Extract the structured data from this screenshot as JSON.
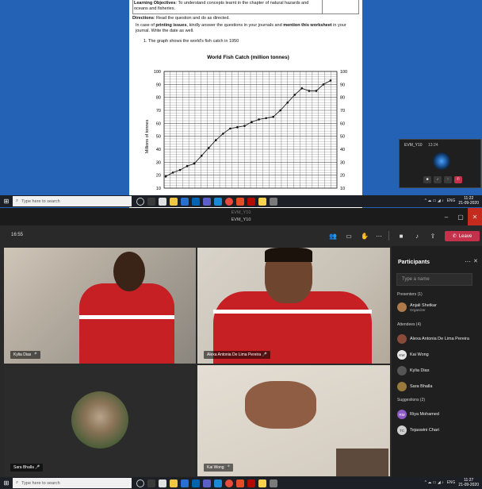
{
  "document": {
    "objectives_label": "Learning Objectives",
    "objectives_text": ": To understand concepts learnt in the chapter of natural hazards and",
    "objectives_text2": "oceans and fisheries.",
    "directions_label": "Directions",
    "directions_text": ": Read the question and do as directed.",
    "instr_a": "In case of ",
    "instr_b": "printing issues",
    "instr_c": ", kindly answer the questions in your journals and ",
    "instr_d": "mention this worksheet",
    "instr_e": " in your",
    "instr_line2": "journal. Write the date as well.",
    "question": "1.   The graph shows the world's fish catch in 1950"
  },
  "chart_data": {
    "type": "line",
    "title": "World Fish Catch (million tonnes)",
    "ylabel": "Millions of tonnes",
    "ylim": [
      10,
      100
    ],
    "yticks": [
      "100",
      "90",
      "80",
      "70",
      "60",
      "50",
      "40",
      "30",
      "20",
      "10"
    ],
    "grid": true,
    "values": [
      19,
      22,
      24,
      27,
      29,
      35,
      41,
      47,
      52,
      56,
      57,
      58,
      61,
      63,
      64,
      65,
      70,
      76,
      82,
      87,
      85,
      85,
      90,
      93
    ]
  },
  "mini_call": {
    "title": "EVM_Y10",
    "time": "13:24"
  },
  "taskbar": {
    "search_placeholder": "Type here to search",
    "tray_lang": "ENG",
    "time_top": "11:22",
    "date_top": "21-09-2020",
    "time_bottom": "11:27",
    "date_bottom": "21-09-2020"
  },
  "window": {
    "title_faint": "EVM_Y10",
    "title": "EVM_Y10"
  },
  "call": {
    "elapsed": "16:55",
    "leave_label": "Leave"
  },
  "tiles": [
    {
      "name": "Kylia Dias"
    },
    {
      "name": "Alexa Antonia De Lima Pereira"
    },
    {
      "name": "Sara Bhalla"
    },
    {
      "name": "Kai Wong"
    }
  ],
  "participants": {
    "header": "Participants",
    "invite_placeholder": "Type a name",
    "presenters_label": "Presenters (1)",
    "presenters": [
      {
        "name": "Anjali Shetkar",
        "role": "Organizer",
        "color": "#b0794a",
        "initials": ""
      }
    ],
    "attendees_label": "Attendees (4)",
    "attendees": [
      {
        "name": "Alexa Antonia De Lima Pereira",
        "color": "#8a4a3a",
        "initials": ""
      },
      {
        "name": "Kai Wong",
        "color": "#e8e8e8",
        "initials": "KW"
      },
      {
        "name": "Kylia Dias",
        "color": "#555555",
        "initials": ""
      },
      {
        "name": "Sara Bhalla",
        "color": "#9a7a3a",
        "initials": ""
      }
    ],
    "suggestions_label": "Suggestions (2)",
    "suggestions": [
      {
        "name": "Riya Mohamed",
        "color": "#8e5bc7",
        "initials": "RM"
      },
      {
        "name": "Tejaswini Chari",
        "color": "#cfcfcf",
        "initials": "TC"
      }
    ]
  }
}
